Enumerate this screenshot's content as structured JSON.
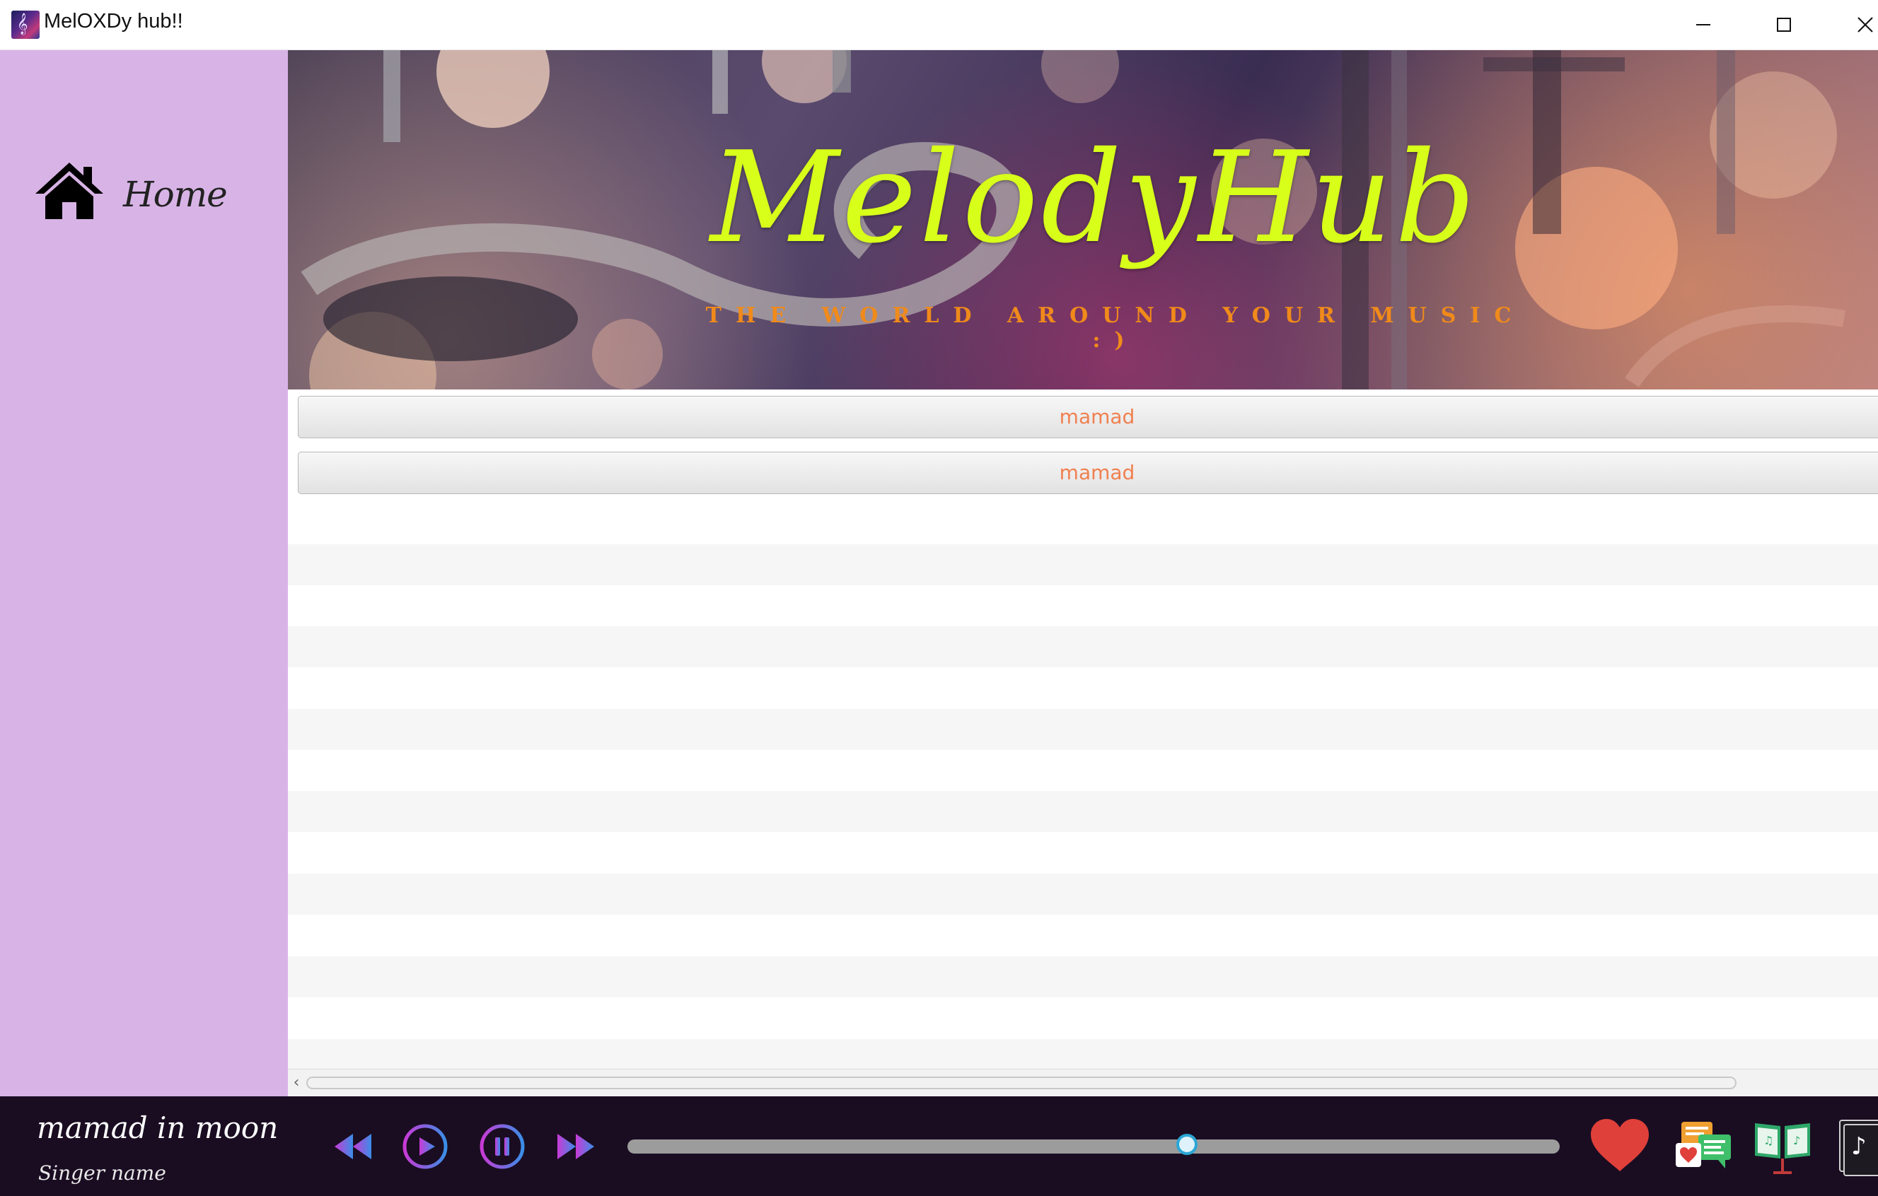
{
  "window": {
    "title": "MelOXDy hub!!",
    "icon": "treble-clef-app-icon",
    "controls": [
      "minimize-icon",
      "maximize-icon",
      "close-icon"
    ]
  },
  "sidebar": {
    "items": [
      {
        "label": "Home",
        "icon": "home-icon"
      }
    ]
  },
  "banner": {
    "logo": "MelodyHub",
    "tagline": "THE WORLD AROUND YOUR MUSIC :)",
    "logo_color": "#d8ff1a",
    "tagline_color": "#f08a1a"
  },
  "songs": [
    {
      "label": "mamad"
    },
    {
      "label": "mamad"
    }
  ],
  "player": {
    "song_title": "mamad in moon",
    "singer_label": "Singer name",
    "progress": 0.6,
    "controls": [
      "rewind-icon",
      "play-icon",
      "pause-icon",
      "fast-forward-icon"
    ],
    "tools": [
      "heart-icon",
      "comments-icon",
      "lyrics-book-icon",
      "music-file-icon"
    ],
    "accent_colors": [
      "#c93ad6",
      "#3a8ee8"
    ],
    "heart_color": "#e0403a"
  },
  "colors": {
    "sidebar": "#d8b4e6",
    "player_bg": "#1a0d22",
    "song_text": "#f08050"
  }
}
